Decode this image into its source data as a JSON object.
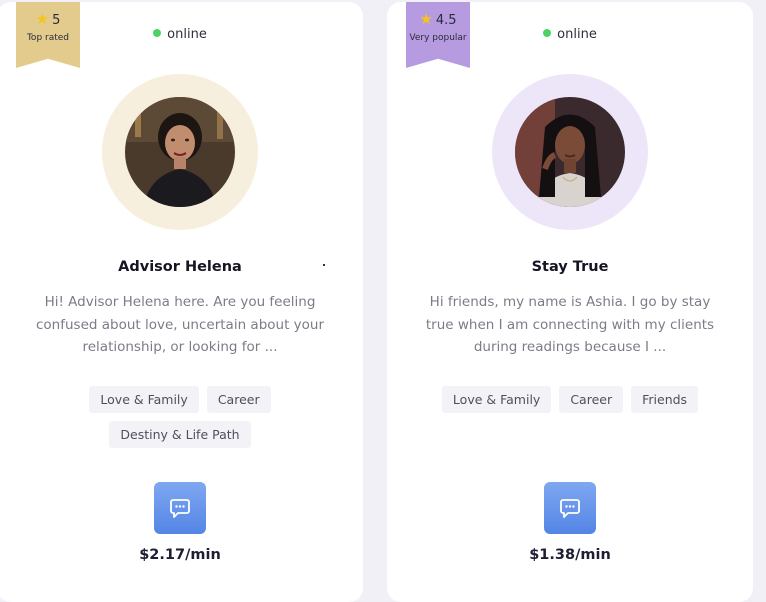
{
  "advisors": [
    {
      "badge": {
        "rating": "5",
        "label": "Top rated",
        "color": "#e3cb8e"
      },
      "status": "online",
      "ring_color": "#f6efdd",
      "name": "Advisor Helena",
      "bio": "Hi! Advisor Helena here. Are you feeling confused about love, uncertain about your relationship, or looking for ...",
      "tags": [
        "Love & Family",
        "Career",
        "Destiny & Life Path"
      ],
      "chat_icon": "chat-bubble-icon",
      "price": "$2.17/min"
    },
    {
      "badge": {
        "rating": "4.5",
        "label": "Very popular",
        "color": "#b69be0"
      },
      "status": "online",
      "ring_color": "#ece6f8",
      "name": "Stay True",
      "bio": "Hi friends, my name is Ashia. I go by stay true when I am connecting with my clients during readings because I ...",
      "tags": [
        "Love & Family",
        "Career",
        "Friends"
      ],
      "chat_icon": "chat-bubble-icon",
      "price": "$1.38/min"
    }
  ]
}
